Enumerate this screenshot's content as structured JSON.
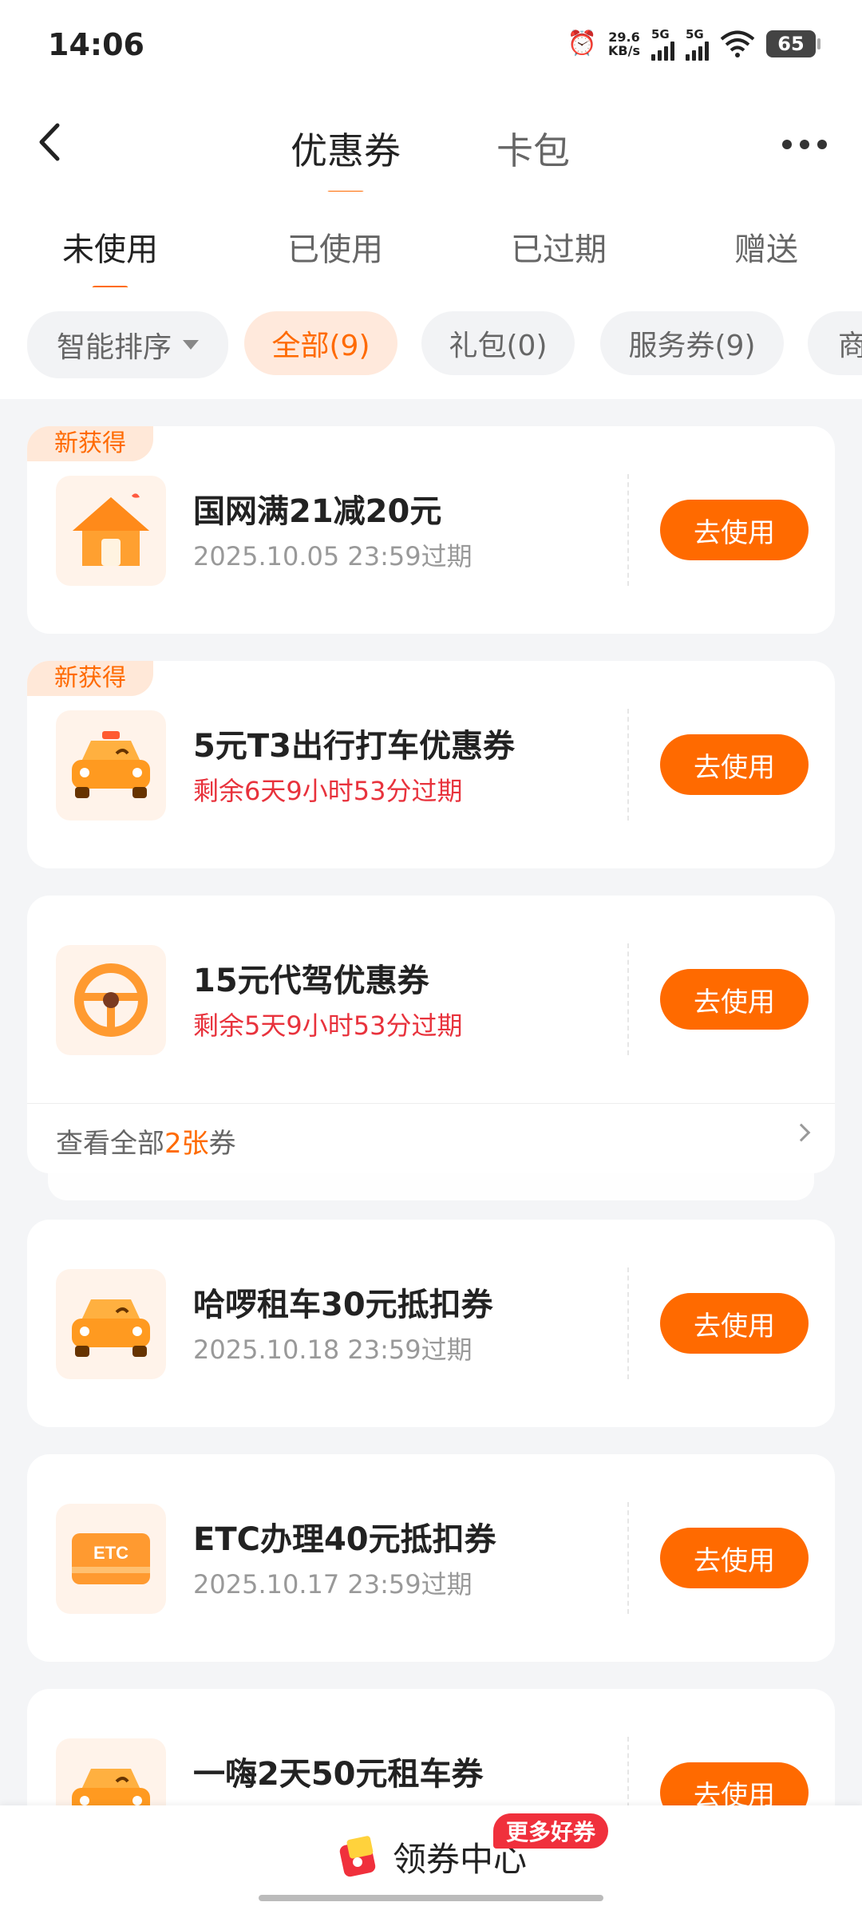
{
  "status_bar": {
    "time": "14:06",
    "net_speed_value": "29.6",
    "net_speed_unit": "KB/s",
    "sim1": "5G",
    "sim2": "5G",
    "battery": "65"
  },
  "header": {
    "tabs": [
      {
        "label": "优惠券",
        "active": true
      },
      {
        "label": "卡包",
        "active": false
      }
    ]
  },
  "subtabs": [
    {
      "label": "未使用",
      "active": true
    },
    {
      "label": "已使用",
      "active": false
    },
    {
      "label": "已过期",
      "active": false
    },
    {
      "label": "赠送",
      "active": false
    }
  ],
  "filters": {
    "sort_label": "智能排序",
    "chips": [
      {
        "label": "全部(9)",
        "active": true
      },
      {
        "label": "礼包(0)",
        "active": false
      },
      {
        "label": "服务券(9)",
        "active": false
      },
      {
        "label": "商",
        "active": false
      }
    ]
  },
  "coupons": [
    {
      "badge": "新获得",
      "icon": "house-icon",
      "title": "国网满21减20元",
      "expire": "2025.10.05 23:59过期",
      "expire_urgent": false,
      "button": "去使用"
    },
    {
      "badge": "新获得",
      "icon": "taxi-icon",
      "title": "5元T3出行打车优惠券",
      "expire": "剩余6天9小时53分过期",
      "expire_urgent": true,
      "button": "去使用"
    },
    {
      "badge": "",
      "icon": "steering-wheel-icon",
      "title": "15元代驾优惠券",
      "expire": "剩余5天9小时53分过期",
      "expire_urgent": true,
      "button": "去使用"
    },
    {
      "badge": "",
      "icon": "car-icon",
      "title": "哈啰租车30元抵扣券",
      "expire": "2025.10.18 23:59过期",
      "expire_urgent": false,
      "button": "去使用"
    },
    {
      "badge": "",
      "icon": "etc-card-icon",
      "title": "ETC办理40元抵扣券",
      "expire": "2025.10.17 23:59过期",
      "expire_urgent": false,
      "button": "去使用"
    },
    {
      "badge": "",
      "icon": "car-icon",
      "title": "一嗨2天50元租车券",
      "expire": "",
      "expire_urgent": false,
      "button": "去使用"
    }
  ],
  "group_footer": {
    "prefix": "查看全部",
    "count": "2张",
    "suffix": "券"
  },
  "bottom_bar": {
    "label": "领券中心",
    "badge": "更多好券",
    "icon": "coupon-center-icon"
  },
  "colors": {
    "accent": "#ff6a00",
    "urgent": "#e8323c",
    "badge_bg": "#ffe8d8"
  }
}
